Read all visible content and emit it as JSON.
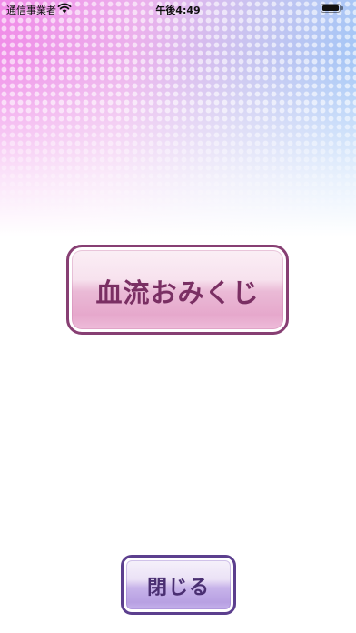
{
  "status_bar": {
    "carrier": "通信事業者",
    "time": "午後4:49",
    "wifi_icon": "wifi-icon",
    "battery_icon": "battery-icon"
  },
  "main": {
    "omikuji_button_label": "血流おみくじ",
    "close_button_label": "閉じる"
  },
  "colors": {
    "omikuji_border": "#873f73",
    "omikuji_text": "#7a2f63",
    "close_border": "#5c3f8e",
    "close_text": "#4a2f72",
    "gradient_pink": "#f08ce8",
    "gradient_blue": "#9cc8f8"
  }
}
